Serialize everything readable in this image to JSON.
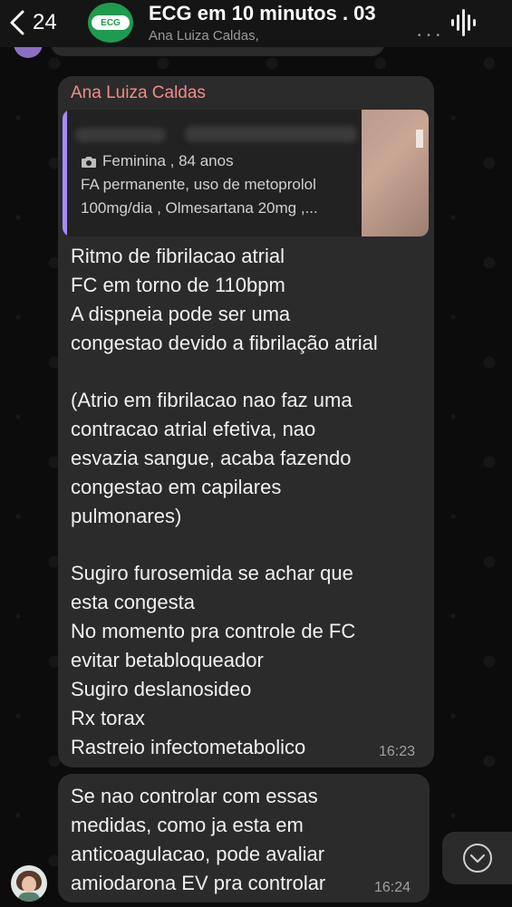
{
  "header": {
    "back_count": "24",
    "group_logo_text": "ECG",
    "title": "ECG em 10 minutos . 03",
    "subtitle": "Ana Luiza Caldas,",
    "more_dots": "• • •"
  },
  "messages": [
    {
      "sender": "Ana Luiza Caldas",
      "reply": {
        "line1": "Feminina , 84 anos",
        "line2": "FA permanente, uso de metoprolol",
        "line3": "100mg/dia , Olmesartana 20mg ,..."
      },
      "lines": [
        "Ritmo de fibrilacao atrial",
        "FC em torno de 110bpm",
        "A dispneia pode ser uma",
        "congestao devido a fibrilação atrial",
        "",
        "(Atrio em fibrilacao nao faz uma",
        "contracao atrial efetiva, nao",
        "esvazia sangue, acaba fazendo",
        "congestao em capilares",
        "pulmonares)",
        "",
        "Sugiro furosemida se achar que",
        "esta congesta",
        "No momento pra controle de FC",
        "evitar betabloqueador",
        "Sugiro deslanosideo",
        "Rx torax",
        "Rastreio infectometabolico"
      ],
      "time": "16:23"
    },
    {
      "lines": [
        "Se nao controlar com essas",
        "medidas, como ja esta em",
        "anticoagulacao, pode avaliar",
        "amiodarona EV pra controlar"
      ],
      "time": "16:24"
    }
  ],
  "colors": {
    "sender_name": "#f38a8a",
    "reply_bar": "#a78bfa",
    "group_avatar": "#1f9b4f",
    "bubble": "#2b2b2b"
  }
}
